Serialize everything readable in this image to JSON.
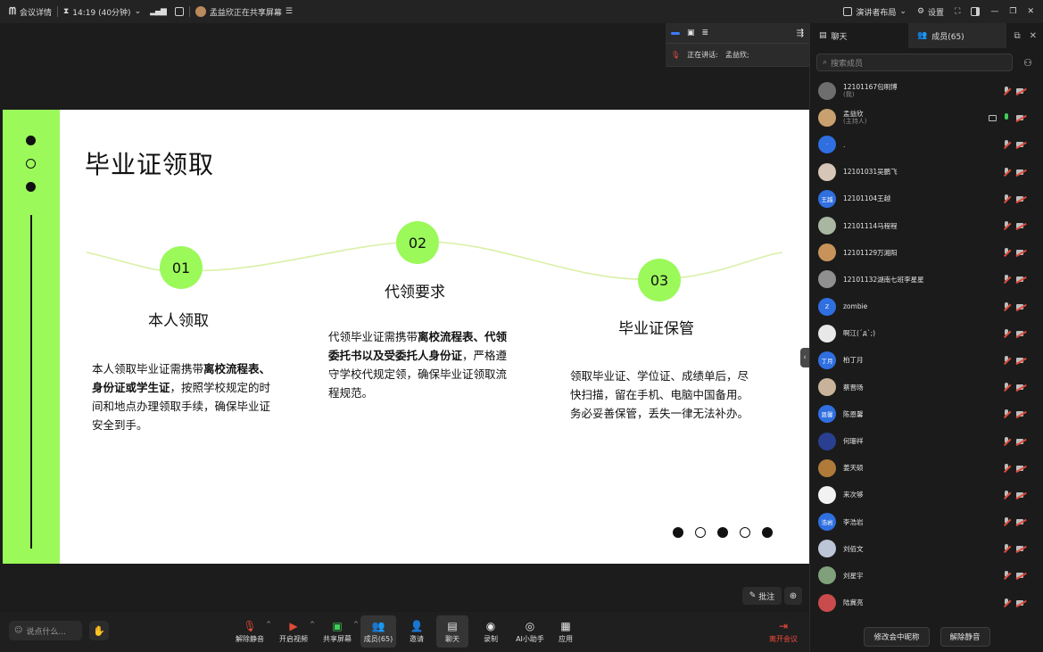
{
  "topbar": {
    "meeting_info": "会议详情",
    "time": "14:19 (40分钟)",
    "sharing_notice": "孟益欣正在共享屏幕",
    "presenter_layout": "演讲者布局",
    "settings": "设置"
  },
  "speaker": {
    "label": "正在讲话:",
    "name": "孟益欣;"
  },
  "slide": {
    "title": "毕业证领取",
    "steps": [
      {
        "num": "01",
        "heading": "本人领取",
        "text_parts": [
          "本人领取毕业证需携带",
          "离校流程表、身份证或学生证",
          "，按照学校规定的时间和地点办理领取手续，确保毕业证安全到手。"
        ]
      },
      {
        "num": "02",
        "heading": "代领要求",
        "text_parts": [
          "代领毕业证需携带",
          "离校流程表、代领委托书以及受委托人身份证",
          "，严格遵守学校代规定领，确保毕业证领取流程规范。"
        ]
      },
      {
        "num": "03",
        "heading": "毕业证保管",
        "text_parts": [
          "领取毕业证、学位证、成绩单后，尽快扫描，留在手机、电脑中国备用。务必妥善保管，丢失一律无法补办。",
          "",
          ""
        ]
      }
    ]
  },
  "stage_buttons": {
    "annotate": "批注"
  },
  "toolbar": {
    "chat_placeholder": "说点什么...",
    "buttons": [
      {
        "label": "解除静音",
        "icon": "mic-off-icon"
      },
      {
        "label": "开启视频",
        "icon": "camera-off-icon"
      },
      {
        "label": "共享屏幕",
        "icon": "share-screen-icon"
      },
      {
        "label": "成员(65)",
        "icon": "members-icon"
      },
      {
        "label": "邀请",
        "icon": "invite-icon"
      },
      {
        "label": "聊天",
        "icon": "chat-icon"
      },
      {
        "label": "录制",
        "icon": "record-icon"
      },
      {
        "label": "AI小助手",
        "icon": "ai-assistant-icon"
      },
      {
        "label": "应用",
        "icon": "apps-icon"
      }
    ],
    "leave": "离开会议"
  },
  "sidebar": {
    "tab_chat": "聊天",
    "tab_members": "成员(65)",
    "search_placeholder": "搜索成员",
    "members": [
      {
        "name": "12101167包明博",
        "sub": "(我)",
        "avatar": "",
        "color": "#6e6e6e"
      },
      {
        "name": "孟益欣",
        "sub": "(主持人)",
        "avatar": "",
        "color": "#c9a16f"
      },
      {
        "name": ".",
        "sub": "",
        "avatar": "·",
        "color": "#2f6fe0"
      },
      {
        "name": "12101031吴鹏飞",
        "sub": "",
        "avatar": "",
        "color": "#d6c6b8"
      },
      {
        "name": "12101104王越",
        "sub": "",
        "avatar": "王越",
        "color": "#2f6fe0"
      },
      {
        "name": "12101114马程程",
        "sub": "",
        "avatar": "",
        "color": "#a9b6a0"
      },
      {
        "name": "12101129万湘阳",
        "sub": "",
        "avatar": "",
        "color": "#c8935a"
      },
      {
        "name": "12101132湖南七班李星星",
        "sub": "",
        "avatar": "",
        "color": "#8f8f8f"
      },
      {
        "name": "zombie",
        "sub": "",
        "avatar": "Z",
        "color": "#2f6fe0"
      },
      {
        "name": "啊江(´д`;)",
        "sub": "",
        "avatar": "",
        "color": "#e8e8e8"
      },
      {
        "name": "柏丁月",
        "sub": "",
        "avatar": "丁月",
        "color": "#2f6fe0"
      },
      {
        "name": "蔡晋旸",
        "sub": "",
        "avatar": "",
        "color": "#c8b39a"
      },
      {
        "name": "陈恩馨",
        "sub": "",
        "avatar": "恩馨",
        "color": "#2f6fe0"
      },
      {
        "name": "何珊祥",
        "sub": "",
        "avatar": "",
        "color": "#2a3f8f"
      },
      {
        "name": "姜天硕",
        "sub": "",
        "avatar": "",
        "color": "#b07a3a"
      },
      {
        "name": "来次够",
        "sub": "",
        "avatar": "",
        "color": "#f2f2f2"
      },
      {
        "name": "李浩岩",
        "sub": "",
        "avatar": "浩岩",
        "color": "#2f6fe0"
      },
      {
        "name": "刘佰文",
        "sub": "",
        "avatar": "",
        "color": "#bcc6d6"
      },
      {
        "name": "刘星宇",
        "sub": "",
        "avatar": "",
        "color": "#7fa07a"
      },
      {
        "name": "陆冀亮",
        "sub": "",
        "avatar": "",
        "color": "#c94b4b"
      }
    ],
    "rename_button": "修改会中昵称",
    "unmute_button": "解除静音"
  }
}
